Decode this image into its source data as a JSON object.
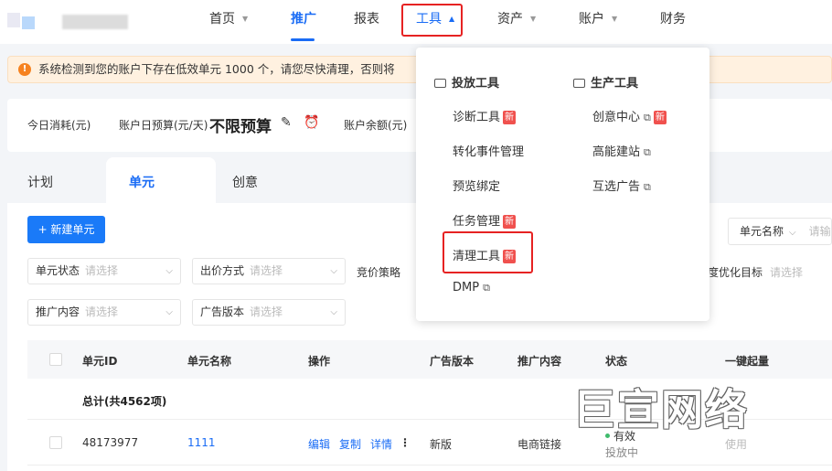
{
  "nav": {
    "items": [
      {
        "label": "首页",
        "has_caret": true
      },
      {
        "label": "推广",
        "active": true
      },
      {
        "label": "报表"
      },
      {
        "label": "工具",
        "has_caret": true,
        "highlighted": true
      },
      {
        "label": "资产",
        "has_caret": true
      },
      {
        "label": "账户",
        "has_caret": true
      },
      {
        "label": "财务"
      }
    ]
  },
  "notice": {
    "text": "系统检测到您的账户下存在低效单元 1000 个，请您尽快清理，否则将"
  },
  "budget": {
    "today_cost_label": "今日消耗(元)",
    "daily_budget_label": "账户日预算(元/天)",
    "daily_budget_value": "不限预算",
    "balance_label": "账户余额(元)"
  },
  "tabs": {
    "plan": "计划",
    "unit": "单元",
    "creative": "创意"
  },
  "toolbar": {
    "new_unit_label": "+ 新建单元",
    "search_field": "单元名称",
    "search_placeholder": "请输"
  },
  "filters": {
    "unit_status": "单元状态",
    "bid_method": "出价方式",
    "bid_strategy": "竞价策略",
    "deep_goal": "度优化目标",
    "promo_content": "推广内容",
    "ad_version": "广告版本",
    "placeholder": "请选择"
  },
  "table": {
    "headers": {
      "unit_id": "单元ID",
      "unit_name": "单元名称",
      "actions": "操作",
      "ad_version": "广告版本",
      "promo_content": "推广内容",
      "status": "状态",
      "one_click": "一键起量"
    },
    "total": "总计(共4562项)",
    "rows": [
      {
        "id": "48173977",
        "name": "1111",
        "action_edit": "编辑",
        "action_copy": "复制",
        "action_detail": "详情",
        "more": "⋮",
        "version": "新版",
        "content": "电商链接",
        "status": "有效",
        "status_sub": "投放中",
        "one_click": "使用"
      }
    ]
  },
  "dropdown": {
    "left_heading": "投放工具",
    "right_heading": "生产工具",
    "new_badge": "新",
    "left_items": [
      {
        "label": "诊断工具",
        "new": true
      },
      {
        "label": "转化事件管理"
      },
      {
        "label": "预览绑定"
      },
      {
        "label": "任务管理",
        "new": true
      },
      {
        "label": "清理工具",
        "new": true,
        "highlighted": true
      },
      {
        "label": "DMP",
        "external": true
      }
    ],
    "right_items": [
      {
        "label": "创意中心",
        "external": true,
        "new": true
      },
      {
        "label": "高能建站",
        "external": true
      },
      {
        "label": "互选广告",
        "external": true
      }
    ]
  },
  "watermark": "巨宣网络",
  "colors": {
    "accent": "#1a6cf5",
    "highlight_box": "#e62222",
    "new_badge": "#f0514e",
    "notice_bg": "#fff1e0",
    "notice_icon": "#f6821f"
  }
}
